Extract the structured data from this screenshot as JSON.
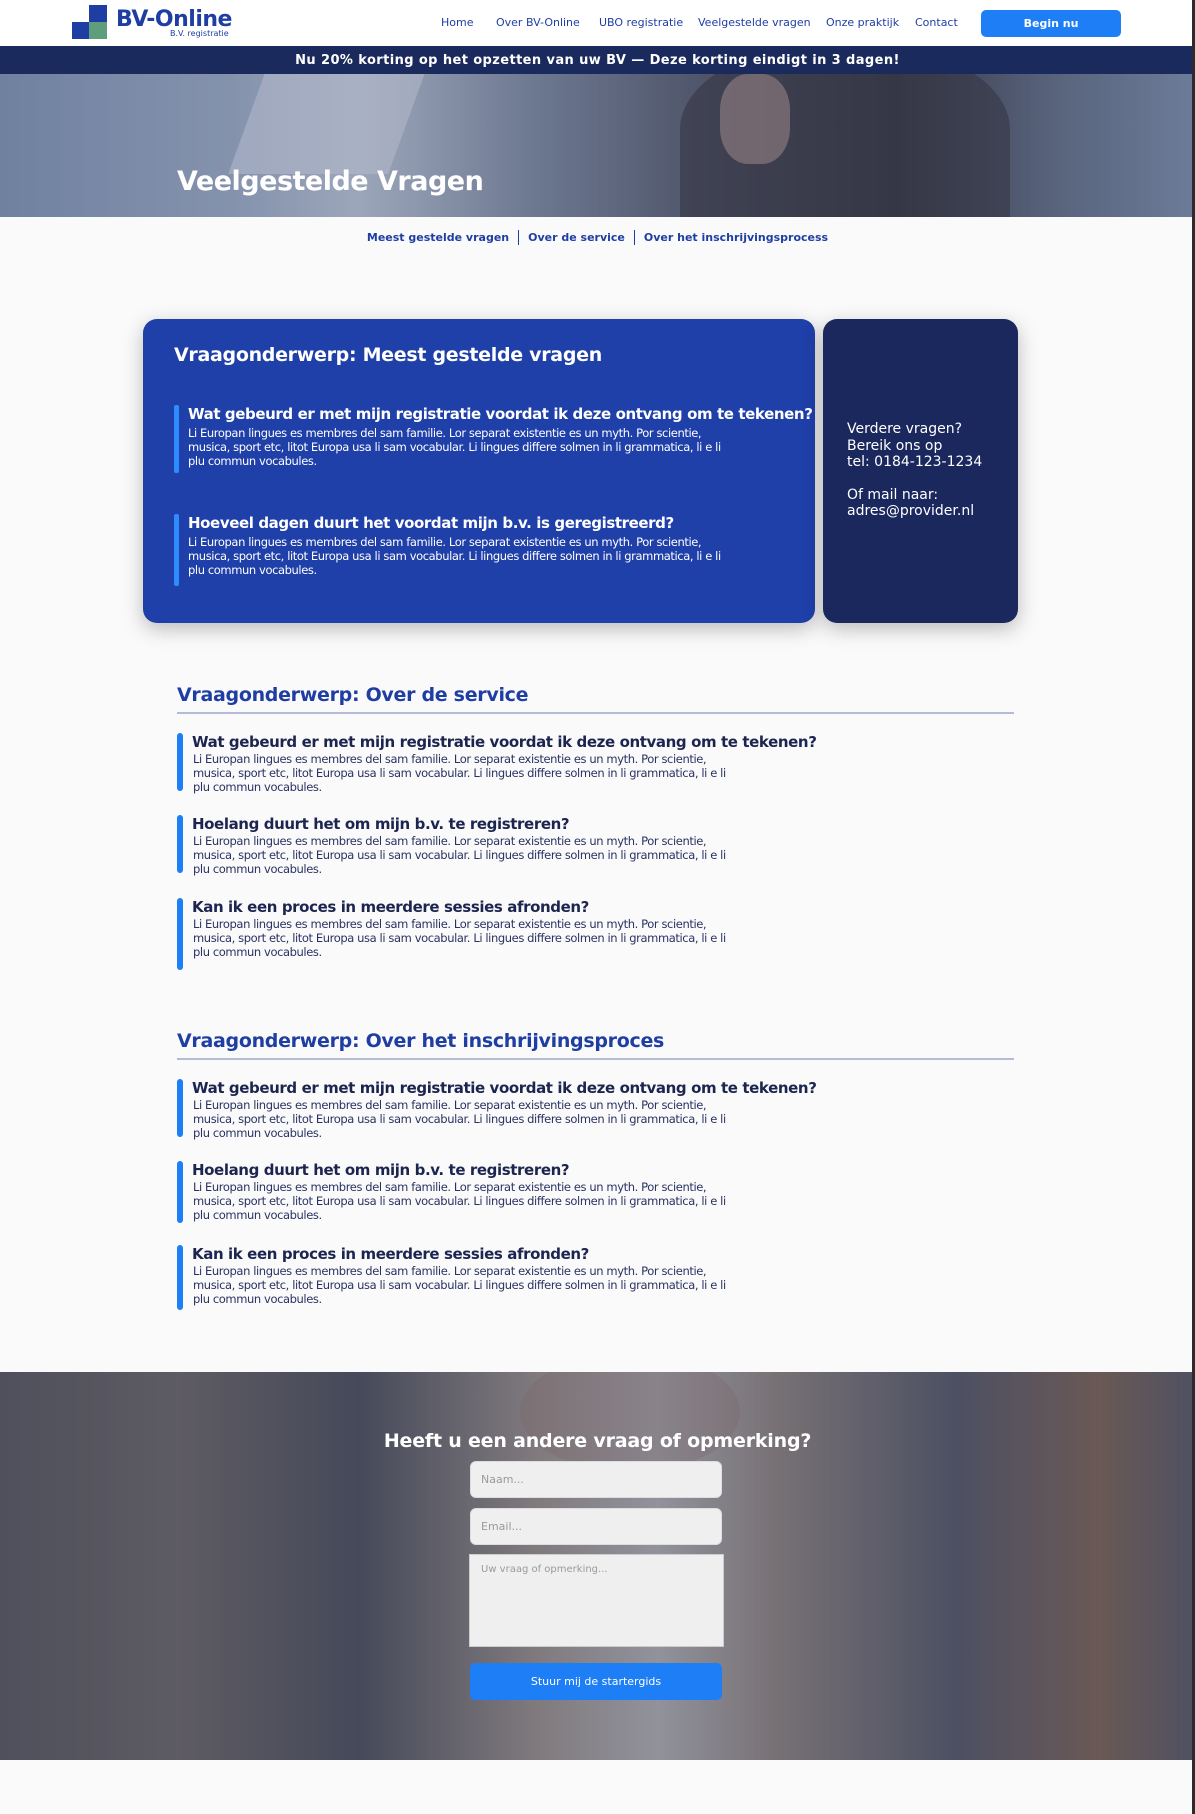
{
  "header": {
    "logo_text": "BV-Online",
    "logo_sub": "B.V. registratie",
    "nav": [
      "Home",
      "Over BV-Online",
      "UBO registratie",
      "Veelgestelde vragen",
      "Onze praktijk",
      "Contact"
    ],
    "cta": "Begin nu"
  },
  "promo": "Nu 20% korting op het opzetten van uw BV — Deze korting eindigt in 3 dagen!",
  "hero": {
    "title": "Veelgestelde Vragen"
  },
  "subnav": [
    "Meest gestelde vragen",
    "Over de service",
    "Over het inschrijvingsprocess"
  ],
  "featured": {
    "title": "Vraagonderwerp: Meest gestelde vragen",
    "items": [
      {
        "question": "Wat gebeurd er met mijn registratie voordat ik deze ontvang om te tekenen?",
        "answer": "Li Europan lingues es membres del sam familie. Lor separat existentie es un myth. Por scientie, musica, sport etc, litot Europa usa li sam vocabular. Li lingues differe solmen in li grammatica, li  e li plu commun vocabules."
      },
      {
        "question": "Hoeveel dagen duurt het voordat mijn b.v. is geregistreerd?",
        "answer": "Li Europan lingues es membres del sam familie. Lor separat existentie es un myth. Por scientie, musica, sport etc, litot Europa usa li sam vocabular. Li lingues differe solmen in li grammatica, li  e li plu commun vocabules."
      }
    ]
  },
  "sidebar": {
    "line1": "Verdere vragen?",
    "line2": "Bereik ons op",
    "line3": "tel: 0184-123-1234",
    "line4": "Of mail naar:",
    "line5": "adres@provider.nl"
  },
  "topics": [
    {
      "title": "Vraagonderwerp: Over de service",
      "items": [
        {
          "question": "Wat gebeurd er met mijn registratie voordat ik deze ontvang om te tekenen?",
          "answer": "Li Europan lingues es membres del sam familie. Lor separat existentie es un myth. Por scientie, musica, sport etc, litot Europa usa li sam vocabular. Li lingues differe solmen in li grammatica, li  e li plu commun vocabules."
        },
        {
          "question": "Hoelang duurt het om mijn b.v. te registreren?",
          "answer": "Li Europan lingues es membres del sam familie. Lor separat existentie es un myth. Por scientie, musica, sport etc, litot Europa usa li sam vocabular. Li lingues differe solmen in li grammatica, li  e li plu commun vocabules."
        },
        {
          "question": "Kan ik een proces in meerdere sessies afronden?",
          "answer": "Li Europan lingues es membres del sam familie. Lor separat existentie es un myth. Por scientie, musica, sport etc, litot Europa usa li sam vocabular. Li lingues differe solmen in li grammatica, li  e li plu commun vocabules."
        }
      ]
    },
    {
      "title": "Vraagonderwerp: Over het inschrijvingsproces",
      "items": [
        {
          "question": "Wat gebeurd er met mijn registratie voordat ik deze ontvang om te tekenen?",
          "answer": "Li Europan lingues es membres del sam familie. Lor separat existentie es un myth. Por scientie, musica, sport etc, litot Europa usa li sam vocabular. Li lingues differe solmen in li grammatica, li  e li plu commun vocabules."
        },
        {
          "question": "Hoelang duurt het om mijn b.v. te registreren?",
          "answer": "Li Europan lingues es membres del sam familie. Lor separat existentie es un myth. Por scientie, musica, sport etc, litot Europa usa li sam vocabular. Li lingues differe solmen in li grammatica, li  e li plu commun vocabules."
        },
        {
          "question": "Kan ik een proces in meerdere sessies afronden?",
          "answer": "Li Europan lingues es membres del sam familie. Lor separat existentie es un myth. Por scientie, musica, sport etc, litot Europa usa li sam vocabular. Li lingues differe solmen in li grammatica, li  e li plu commun vocabules."
        }
      ]
    }
  ],
  "contact": {
    "title": "Heeft u een andere vraag of opmerking?",
    "name_placeholder": "Naam...",
    "email_placeholder": "Email...",
    "message_placeholder": "Uw vraag of opmerking...",
    "submit": "Stuur mij de startergids"
  },
  "colors": {
    "brand_blue": "#1f3ea3",
    "navy": "#1b285d",
    "accent": "#1e7ef5"
  }
}
